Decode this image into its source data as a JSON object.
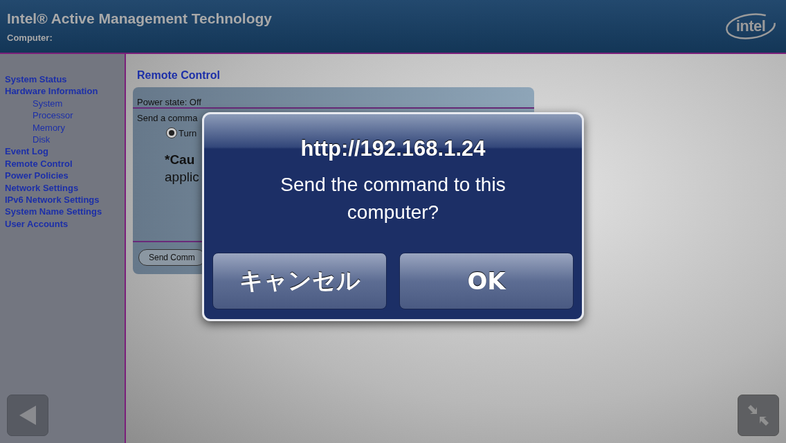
{
  "header": {
    "title": "Intel® Active Management Technology",
    "subtitle": "Computer:",
    "logo_text": "intel"
  },
  "sidebar": {
    "items": [
      {
        "label": "System Status"
      },
      {
        "label": "Hardware Information",
        "children": [
          {
            "label": "System"
          },
          {
            "label": "Processor"
          },
          {
            "label": "Memory"
          },
          {
            "label": "Disk"
          }
        ]
      },
      {
        "label": "Event Log"
      },
      {
        "label": "Remote Control"
      },
      {
        "label": "Power Policies"
      },
      {
        "label": "Network Settings"
      },
      {
        "label": "IPv6 Network Settings"
      },
      {
        "label": "System Name Settings"
      },
      {
        "label": "User Accounts"
      }
    ]
  },
  "content": {
    "heading": "Remote Control",
    "power_state": "Power state: Off",
    "send_label": "Send a comma",
    "options": [
      {
        "label": "Turn",
        "selected": true
      }
    ],
    "caution_label": "*Cau",
    "caution_text": "applic",
    "send_button": "Send Comm"
  },
  "dialog": {
    "title": "http://192.168.1.24",
    "message": "Send the command to this computer?",
    "buttons": [
      {
        "label": "キャンセル"
      },
      {
        "label": "OK"
      }
    ]
  }
}
